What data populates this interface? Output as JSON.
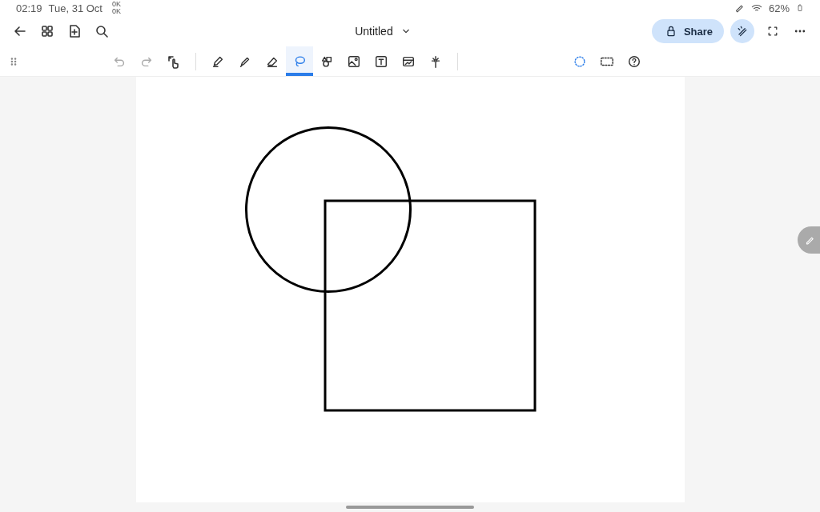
{
  "status_bar": {
    "time": "02:19",
    "date": "Tue, 31 Oct",
    "net_speed": [
      "0K",
      "0K"
    ],
    "battery": "62%"
  },
  "header": {
    "title": "Untitled",
    "share_label": "Share"
  },
  "tools": [
    {
      "kind": "pen",
      "selected": false
    },
    {
      "kind": "highlighter",
      "selected": false
    },
    {
      "kind": "eraser",
      "selected": false
    },
    {
      "kind": "lasso",
      "selected": true
    },
    {
      "kind": "shapes",
      "selected": false
    },
    {
      "kind": "image",
      "selected": false
    },
    {
      "kind": "text",
      "selected": false
    },
    {
      "kind": "chart",
      "selected": false
    },
    {
      "kind": "laser",
      "selected": false
    }
  ],
  "select_modes": [
    {
      "kind": "lasso",
      "selected": true
    },
    {
      "kind": "rectangle",
      "selected": false
    }
  ],
  "canvas": {
    "shapes": [
      {
        "kind": "circle"
      },
      {
        "kind": "square"
      }
    ]
  }
}
